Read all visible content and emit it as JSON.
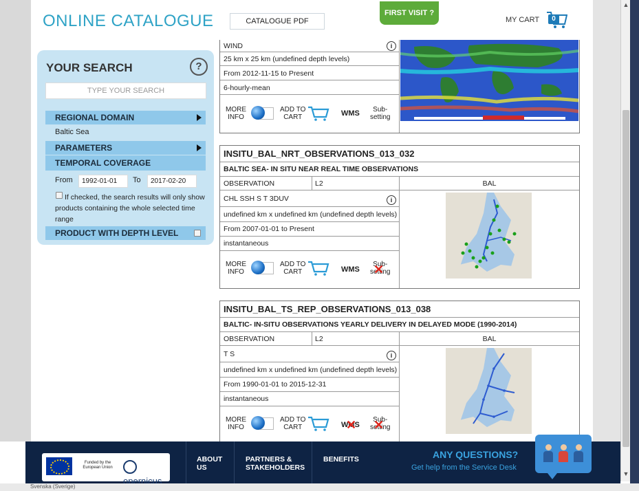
{
  "window": {
    "status_locale": "Svenska (Sverige)"
  },
  "header": {
    "logo": "ONLINE CATALOGUE",
    "catalogue_pdf": "CATALOGUE PDF",
    "first_visit": "FIRST VISIT ?",
    "my_cart": "MY CART",
    "cart_count": "0"
  },
  "search": {
    "title": "YOUR SEARCH",
    "help": "?",
    "placeholder": "TYPE YOUR SEARCH",
    "regional_domain": "REGIONAL DOMAIN",
    "regional_value": "Baltic Sea",
    "parameters": "PARAMETERS",
    "temporal_coverage": "TEMPORAL COVERAGE",
    "from_label": "From",
    "from_value": "1992-01-01",
    "to_label": "To",
    "to_value": "2017-02-20",
    "checkbox_text": "If checked, the search results will only show products containing the whole selected time range",
    "product_depth": "PRODUCT WITH DEPTH LEVEL"
  },
  "actions": {
    "more_info": [
      "MORE",
      "INFO"
    ],
    "add_to_cart": [
      "ADD TO",
      "CART"
    ],
    "wms": "WMS",
    "subsetting": [
      "Sub-",
      "setting"
    ]
  },
  "products": [
    {
      "param": "WIND",
      "resolution": "25 km x 25 km (undefined depth levels)",
      "period": "From 2012-11-15 to Present",
      "frequency": "6-hourly-mean",
      "wms_available": true,
      "subsetting_available": true
    },
    {
      "title": "INSITU_BAL_NRT_OBSERVATIONS_013_032",
      "subtitle": "BALTIC SEA- IN SITU NEAR REAL TIME OBSERVATIONS",
      "type": "OBSERVATION",
      "level": "L2",
      "area": "BAL",
      "param": "CHL SSH S T 3DUV",
      "resolution": "undefined km x undefined km (undefined depth levels)",
      "period": "From 2007-01-01 to Present",
      "frequency": "instantaneous",
      "wms_available": true,
      "subsetting_available": false
    },
    {
      "title": "INSITU_BAL_TS_REP_OBSERVATIONS_013_038",
      "subtitle": "BALTIC- IN-SITU OBSERVATIONS YEARLY DELIVERY IN DELAYED MODE (1990-2014)",
      "type": "OBSERVATION",
      "level": "L2",
      "area": "BAL",
      "param": "T S",
      "resolution": "undefined km x undefined km (undefined depth levels)",
      "period": "From 1990-01-01 to 2015-12-31",
      "frequency": "instantaneous",
      "wms_available": false,
      "subsetting_available": false
    }
  ],
  "footer": {
    "eu_text": "Funded by the European Union",
    "copernicus": "opernicus",
    "about": [
      "ABOUT",
      "US"
    ],
    "partners": [
      "PARTNERS &",
      "STAKEHOLDERS"
    ],
    "benefits": "BENEFITS",
    "any_questions": "ANY QUESTIONS?",
    "help_text": "Get help from the Service Desk"
  },
  "colors": {
    "accent": "#2fa3c6",
    "panel_bg": "#c8e4f3",
    "section_bar": "#8fc8ea",
    "first_visit": "#5dab3a",
    "footer_bg": "#0e2344",
    "footer_accent": "#3aa3e0",
    "unavailable_mark": "#e0261c"
  }
}
